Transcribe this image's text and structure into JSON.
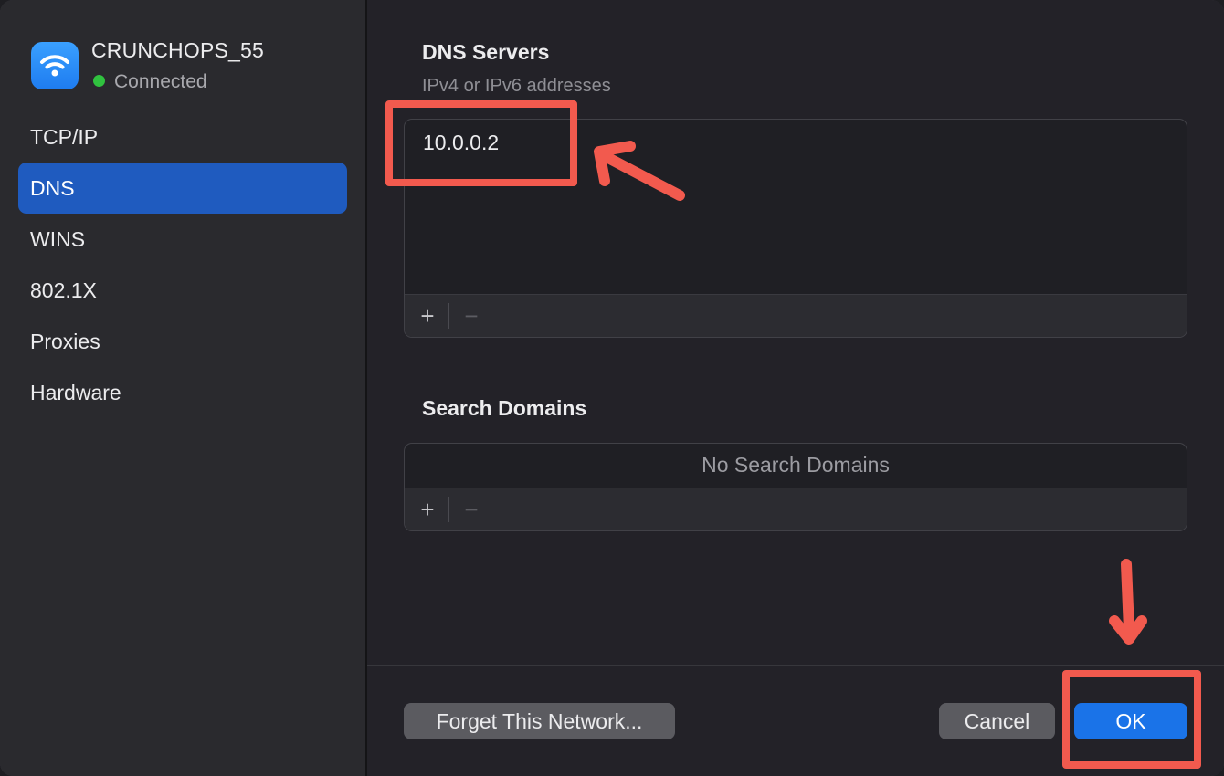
{
  "network": {
    "name": "CRUNCHOPS_55",
    "status": "Connected",
    "status_color": "#30c23f",
    "icon": "wifi-icon"
  },
  "sidebar": {
    "items": [
      {
        "label": "TCP/IP",
        "selected": false
      },
      {
        "label": "DNS",
        "selected": true
      },
      {
        "label": "WINS",
        "selected": false
      },
      {
        "label": "802.1X",
        "selected": false
      },
      {
        "label": "Proxies",
        "selected": false
      },
      {
        "label": "Hardware",
        "selected": false
      }
    ]
  },
  "dns_servers": {
    "title": "DNS Servers",
    "subtitle": "IPv4 or IPv6 addresses",
    "entries": [
      "10.0.0.2"
    ],
    "add_label": "+",
    "remove_label": "−"
  },
  "search_domains": {
    "title": "Search Domains",
    "empty_text": "No Search Domains",
    "add_label": "+",
    "remove_label": "−"
  },
  "footer": {
    "forget_label": "Forget This Network...",
    "cancel_label": "Cancel",
    "ok_label": "OK"
  },
  "colors": {
    "accent": "#1a73e8",
    "selection": "#1f5bbf",
    "annotation": "#f25a4e"
  }
}
